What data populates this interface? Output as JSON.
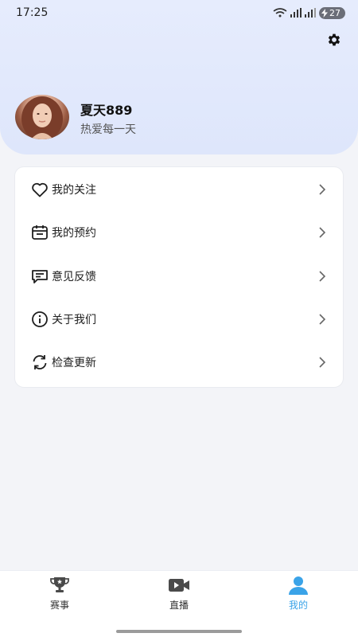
{
  "status_bar": {
    "time": "17:25",
    "battery": "27"
  },
  "profile": {
    "name": "夏天889",
    "subtitle": "热爱每一天"
  },
  "menu": [
    {
      "label": "我的关注",
      "icon": "heart-icon"
    },
    {
      "label": "我的预约",
      "icon": "calendar-icon"
    },
    {
      "label": "意见反馈",
      "icon": "feedback-chat-icon"
    },
    {
      "label": "关于我们",
      "icon": "info-icon"
    },
    {
      "label": "检查更新",
      "icon": "refresh-icon"
    }
  ],
  "tabs": [
    {
      "label": "赛事",
      "icon": "trophy-icon",
      "active": false
    },
    {
      "label": "直播",
      "icon": "video-camera-icon",
      "active": false
    },
    {
      "label": "我的",
      "icon": "person-icon",
      "active": true
    }
  ],
  "colors": {
    "accent": "#3aa3e8",
    "header_bg": "#e3e9fc",
    "page_bg": "#f3f4f8"
  }
}
